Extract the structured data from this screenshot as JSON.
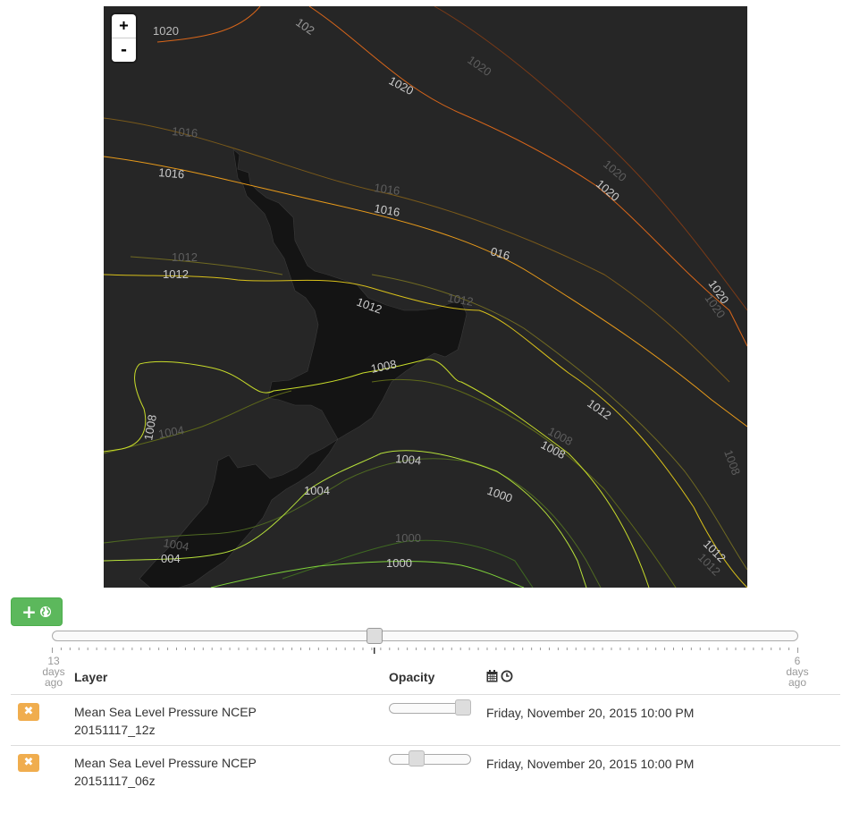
{
  "map": {
    "zoom_in_label": "+",
    "zoom_out_label": "-",
    "background_color": "#262626",
    "land_color": "#141414",
    "contour_labels": [
      "1020",
      "102",
      "1020",
      "1020",
      "1020",
      "1020",
      "1020",
      "1020",
      "1016",
      "1016",
      "1016",
      "1016",
      "016",
      "1012",
      "1012",
      "1012",
      "1012",
      "1012",
      "1012",
      "1012",
      "1008",
      "1008",
      "1008",
      "1008",
      "1008",
      "1004",
      "1004",
      "1004",
      "1004",
      "004",
      "1000",
      "1000"
    ]
  },
  "toolbar": {
    "add_icon": "plus-icon",
    "globe_icon": "globe-icon",
    "add_color": "#5cb85c"
  },
  "timeline": {
    "start_label": [
      "13",
      "days",
      "ago"
    ],
    "end_label": [
      "6",
      "days",
      "ago"
    ],
    "position": 0.432
  },
  "table": {
    "header_layer": "Layer",
    "header_opacity": "Opacity",
    "header_date_icons": [
      "calendar-icon",
      "clock-icon"
    ],
    "rows": [
      {
        "name_line1": "Mean Sea Level Pressure NCEP",
        "name_line2": "20151117_12z",
        "opacity": 1.0,
        "date": "Friday, November 20, 2015 10:00 PM"
      },
      {
        "name_line1": "Mean Sea Level Pressure NCEP",
        "name_line2": "20151117_06z",
        "opacity": 0.3,
        "date": "Friday, November 20, 2015 10:00 PM"
      }
    ],
    "remove_color": "#f0ad4e"
  }
}
